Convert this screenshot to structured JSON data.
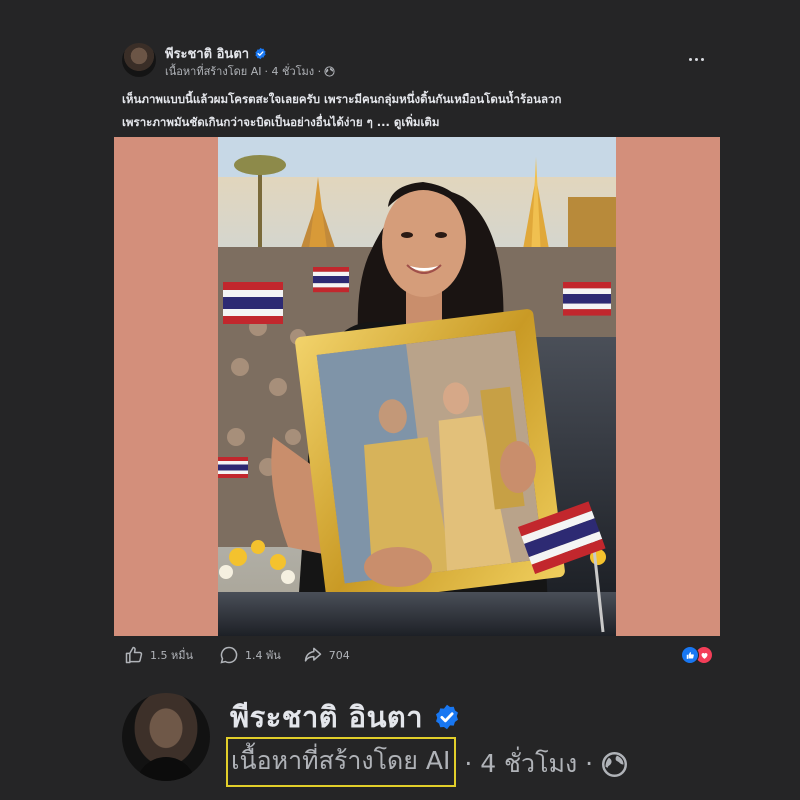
{
  "post": {
    "author_name": "พีระชาติ อินตา",
    "ai_label": "เนื้อหาที่สร้างโดย AI",
    "time_text": "· 4 ชั่วโมง ·",
    "caption_line1": "เห็นภาพแบบนี้แล้วผมโครตสะใจเลยครับ เพราะมีคนกลุ่มหนึ่งดิ้นกันเหมือนโดนน้ำร้อนลวก",
    "caption_line2": "เพราะภาพมันชัดเกินกว่าจะบิดเป็นอย่างอื่นได้ง่าย ๆ ...",
    "see_more": "ดูเพิ่มเติม",
    "icons": {
      "verified": "verified-badge-icon",
      "globe": "globe-icon",
      "more": "more-options-icon"
    }
  },
  "reactions": {
    "likes": "1.5 หมื่น",
    "comments": "1.4 พัน",
    "shares": "704",
    "emoji": [
      "like",
      "love"
    ]
  },
  "zoom": {
    "author_name": "พีระชาติ อินตา",
    "ai_label": "เนื้อหาที่สร้างโดย AI",
    "time_text": "· 4 ชั่วโมง ·"
  },
  "colors": {
    "background": "#252526",
    "photo_padding": "#d38f7b",
    "verified_blue": "#1877f2",
    "highlight_box": "#e2cf2a"
  }
}
